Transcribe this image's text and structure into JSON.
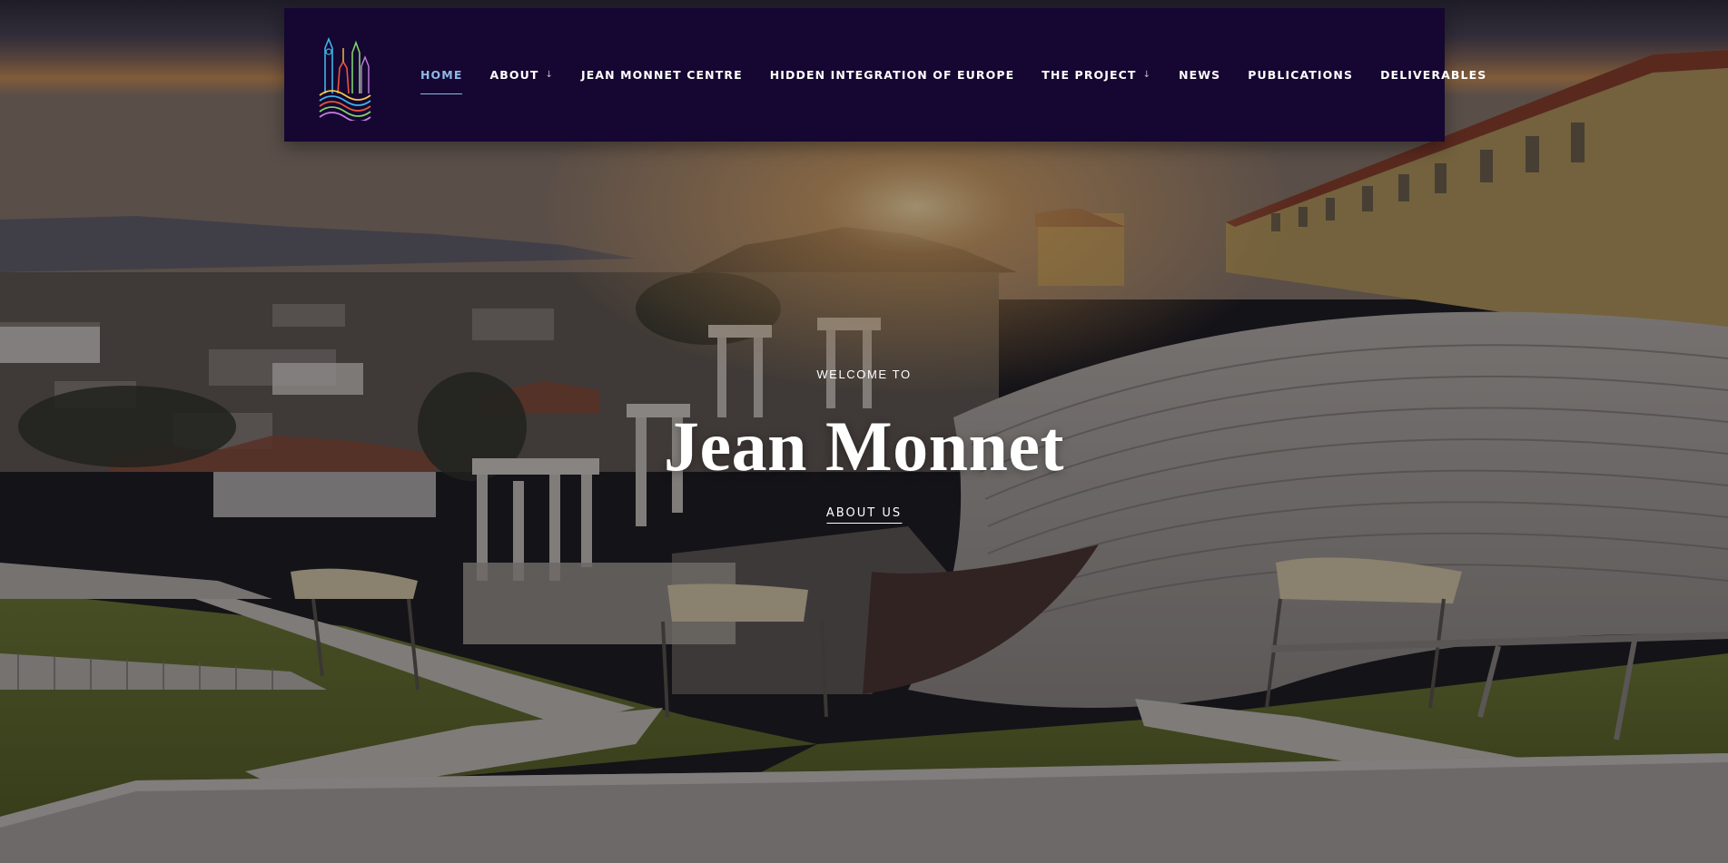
{
  "brand": {
    "logo_icon": "city-skyline-logo-icon"
  },
  "nav": {
    "items": [
      {
        "label": "HOME",
        "active": true,
        "has_dropdown": false
      },
      {
        "label": "ABOUT",
        "active": false,
        "has_dropdown": true
      },
      {
        "label": "JEAN MONNET CENTRE",
        "active": false,
        "has_dropdown": false
      },
      {
        "label": "HIDDEN INTEGRATION OF EUROPE",
        "active": false,
        "has_dropdown": false
      },
      {
        "label": "THE PROJECT",
        "active": false,
        "has_dropdown": true
      },
      {
        "label": "NEWS",
        "active": false,
        "has_dropdown": false
      },
      {
        "label": "PUBLICATIONS",
        "active": false,
        "has_dropdown": false
      },
      {
        "label": "DELIVERABLES",
        "active": false,
        "has_dropdown": false
      }
    ],
    "dropdown_icon": "↓"
  },
  "hero": {
    "welcome": "WELCOME TO",
    "title": "Jean Monnet",
    "link_label": "ABOUT US"
  },
  "colors": {
    "navbar_bg": "#150731",
    "active_link": "#8fb8e8",
    "text": "#ffffff"
  }
}
